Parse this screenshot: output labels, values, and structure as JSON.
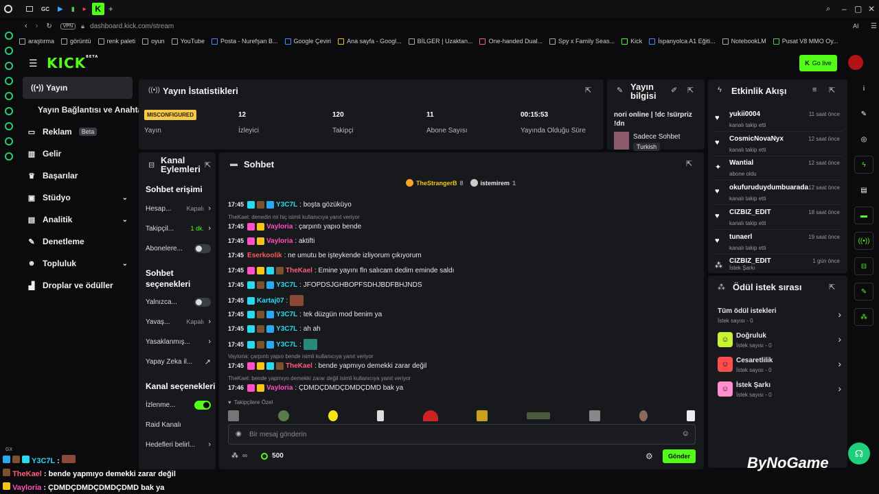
{
  "browser": {
    "tabs": [
      "GC"
    ],
    "url": "dashboard.kick.com/stream",
    "vpn_label": "VPN",
    "ai_label": "AI",
    "bookmarks": [
      "araştırma",
      "görüntü",
      "renk paleti",
      "oyun",
      "YouTube",
      "Posta - Nurefşan B...",
      "Google Çeviri",
      "Ana sayfa - Googl...",
      "BİLGER | Uzaktan...",
      "One-handed Dual...",
      "Spy x Family Seas...",
      "Kick",
      "İspanyolca A1 Eğiti...",
      "NotebookLM",
      "Pusat V8 MMO Oy..."
    ]
  },
  "header": {
    "logo": "KICK",
    "logo_sup": "BETA",
    "golive": "Go live"
  },
  "sidebar": {
    "items": [
      {
        "label": "Yayın",
        "icon": "broadcast-icon"
      },
      {
        "label": "Yayın Bağlantısı ve Anahtarı",
        "icon": ""
      },
      {
        "label": "Reklam",
        "icon": "monitor-icon",
        "badge": "Beta"
      },
      {
        "label": "Gelir",
        "icon": "chart-icon"
      },
      {
        "label": "Başarılar",
        "icon": "trophy-icon"
      },
      {
        "label": "Stüdyo",
        "icon": "studio-icon"
      },
      {
        "label": "Analitik",
        "icon": "analytics-icon"
      },
      {
        "label": "Denetleme",
        "icon": "wrench-icon"
      },
      {
        "label": "Topluluk",
        "icon": "people-icon"
      },
      {
        "label": "Droplar ve ödüller",
        "icon": "drops-icon"
      }
    ]
  },
  "stats": {
    "title": "Yayın İstatistikleri",
    "status_badge": "MISCONFIGURED",
    "status_label": "Yayın",
    "cols": [
      {
        "value": "12",
        "label": "İzleyici"
      },
      {
        "value": "120",
        "label": "Takipçi"
      },
      {
        "value": "11",
        "label": "Abone Sayısı"
      },
      {
        "value": "00:15:53",
        "label": "Yayında Olduğu Süre"
      }
    ]
  },
  "info": {
    "title": "Yayın bilgisi",
    "stream_title": "nori online | !dc !sürpriz !dn",
    "category": "Sadece Sohbet",
    "tag": "Turkish"
  },
  "events": {
    "title": "Etkinlik Akışı",
    "items": [
      {
        "name": "yukii0004",
        "sub": "kanalı takip etti",
        "time": "11 saat önce",
        "icon": "heart-icon"
      },
      {
        "name": "CosmicNovaNyx",
        "sub": "kanalı takip etti",
        "time": "12 saat önce",
        "icon": "heart-icon"
      },
      {
        "name": "Wantial",
        "sub": "abone oldu",
        "time": "12 saat önce",
        "icon": "star-icon"
      },
      {
        "name": "okufuruduydumbuarada",
        "sub": "kanalı takip etti",
        "time": "12 saat önce",
        "icon": "heart-icon"
      },
      {
        "name": "CIZBIZ_EDIT",
        "sub": "kanalı takip etti",
        "time": "18 saat önce",
        "icon": "heart-icon"
      },
      {
        "name": "tunaerl",
        "sub": "kanalı takip etti",
        "time": "19 saat önce",
        "icon": "heart-icon"
      },
      {
        "name": "CIZBIZ_EDIT",
        "sub": "İstek Şarkı",
        "time": "1 gün önce",
        "icon": "reward-icon"
      }
    ]
  },
  "rewards": {
    "title": "Ödül istek sırası",
    "all_label": "Tüm ödül istekleri",
    "all_sub": "İstek sayısı - 0",
    "items": [
      {
        "name": "Doğruluk",
        "sub": "İstek sayısı - 0",
        "color": "#c6f432"
      },
      {
        "name": "Cesaretlilik",
        "sub": "İstek sayısı - 0",
        "color": "#ff4d4d"
      },
      {
        "name": "İstek Şarkı",
        "sub": "İstek sayısı - 0",
        "color": "#ff8fd1"
      }
    ]
  },
  "actions": {
    "title": "Kanal Eylemleri",
    "section1": "Sohbet erişimi",
    "rows1": [
      {
        "label": "Hesap...",
        "val": "Kapalı",
        "kind": "chev"
      },
      {
        "label": "Takipçil...",
        "val": "1 dk.",
        "kind": "chev"
      },
      {
        "label": "Abonelere...",
        "val": "",
        "kind": "toggle"
      }
    ],
    "section2": "Sohbet seçenekleri",
    "rows2": [
      {
        "label": "Yalnızca...",
        "val": "",
        "kind": "toggle"
      },
      {
        "label": "Yavaş...",
        "val": "Kapalı",
        "kind": "chev"
      },
      {
        "label": "Yasaklanmış...",
        "val": "",
        "kind": "chev"
      },
      {
        "label": "Yapay Zeka il...",
        "val": "",
        "kind": "ext"
      }
    ],
    "section3": "Kanal seçenekleri",
    "rows3": [
      {
        "label": "İzlenme...",
        "val": "",
        "kind": "toggle-on"
      },
      {
        "label": "Raid Kanalı",
        "val": "",
        "kind": "none"
      },
      {
        "label": "Hedefleri belirl...",
        "val": "",
        "kind": "chev"
      }
    ]
  },
  "chat": {
    "title": "Sohbet",
    "top_gifters": [
      {
        "name": "TheStrangerB",
        "count": "8"
      },
      {
        "name": "istemirem",
        "count": "1"
      }
    ],
    "messages": [
      {
        "ts": "17:45",
        "user": "Y3C7L",
        "color": "#29d9f0",
        "text": ": boşta gözüküyo"
      },
      {
        "reply": "TheKael: denedin mi hiç isimli kullanıcıya yanıt veriyor"
      },
      {
        "ts": "17:45",
        "user": "Vayloria",
        "color": "#ff4fc1",
        "text": ": çarpıntı yapıo bende"
      },
      {
        "ts": "17:45",
        "user": "Vayloria",
        "color": "#ff4fc1",
        "text": ": aktifti"
      },
      {
        "ts": "17:45",
        "user": "Eserkoolik",
        "color": "#ff5a5a",
        "text": ": ne umutu be işteykende izliyorum çıkıyorum"
      },
      {
        "ts": "17:45",
        "user": "TheKael",
        "color": "#ff5a7a",
        "text": ": Emine yayını fln salıcam dedim eminde saldı"
      },
      {
        "ts": "17:45",
        "user": "Y3C7L",
        "color": "#29d9f0",
        "text": ": JFOPDSJGHBOPFSDHJBDFBHJNDS"
      },
      {
        "ts": "17:45",
        "user": "Kartaj07",
        "color": "#29d9f0",
        "text": ":"
      },
      {
        "ts": "17:45",
        "user": "Y3C7L",
        "color": "#29d9f0",
        "text": ": tek düzgün mod benim ya"
      },
      {
        "ts": "17:45",
        "user": "Y3C7L",
        "color": "#29d9f0",
        "text": ": ah ah"
      },
      {
        "ts": "17:45",
        "user": "Y3C7L",
        "color": "#29d9f0",
        "text": ":"
      },
      {
        "reply": "Vayloria: çarpıntı yapıo bende isimli kullanıcıya yanıt veriyor"
      },
      {
        "ts": "17:45",
        "user": "TheKael",
        "color": "#ff5a7a",
        "text": ": bende yapmıyo demekki zarar değil"
      },
      {
        "reply": "TheKael: bende yapmıyo demekki zarar değil isimli kullanıcıya yanıt veriyor"
      },
      {
        "ts": "17:46",
        "user": "Vayloria",
        "color": "#ff4fc1",
        "text": ": ÇDMDÇDMDÇDMDÇDMD bak ya"
      }
    ],
    "followers_only": "Takipçilere Özel",
    "placeholder": "Bir mesaj gönderin",
    "points": "500",
    "send": "Gönder"
  },
  "overlay": {
    "tag": "GX",
    "lines": [
      {
        "user": "Y3C7L",
        "color": "#29d9f0",
        "text": " :"
      },
      {
        "user": "TheKael",
        "color": "#ff5a7a",
        "text": " : bende yapmıyo demekki zarar değil"
      },
      {
        "user": "Vayloria",
        "color": "#ff4fc1",
        "text": " : ÇDMDÇDMDÇDMDÇDMD bak ya"
      }
    ]
  },
  "brand": "ByNoGame"
}
